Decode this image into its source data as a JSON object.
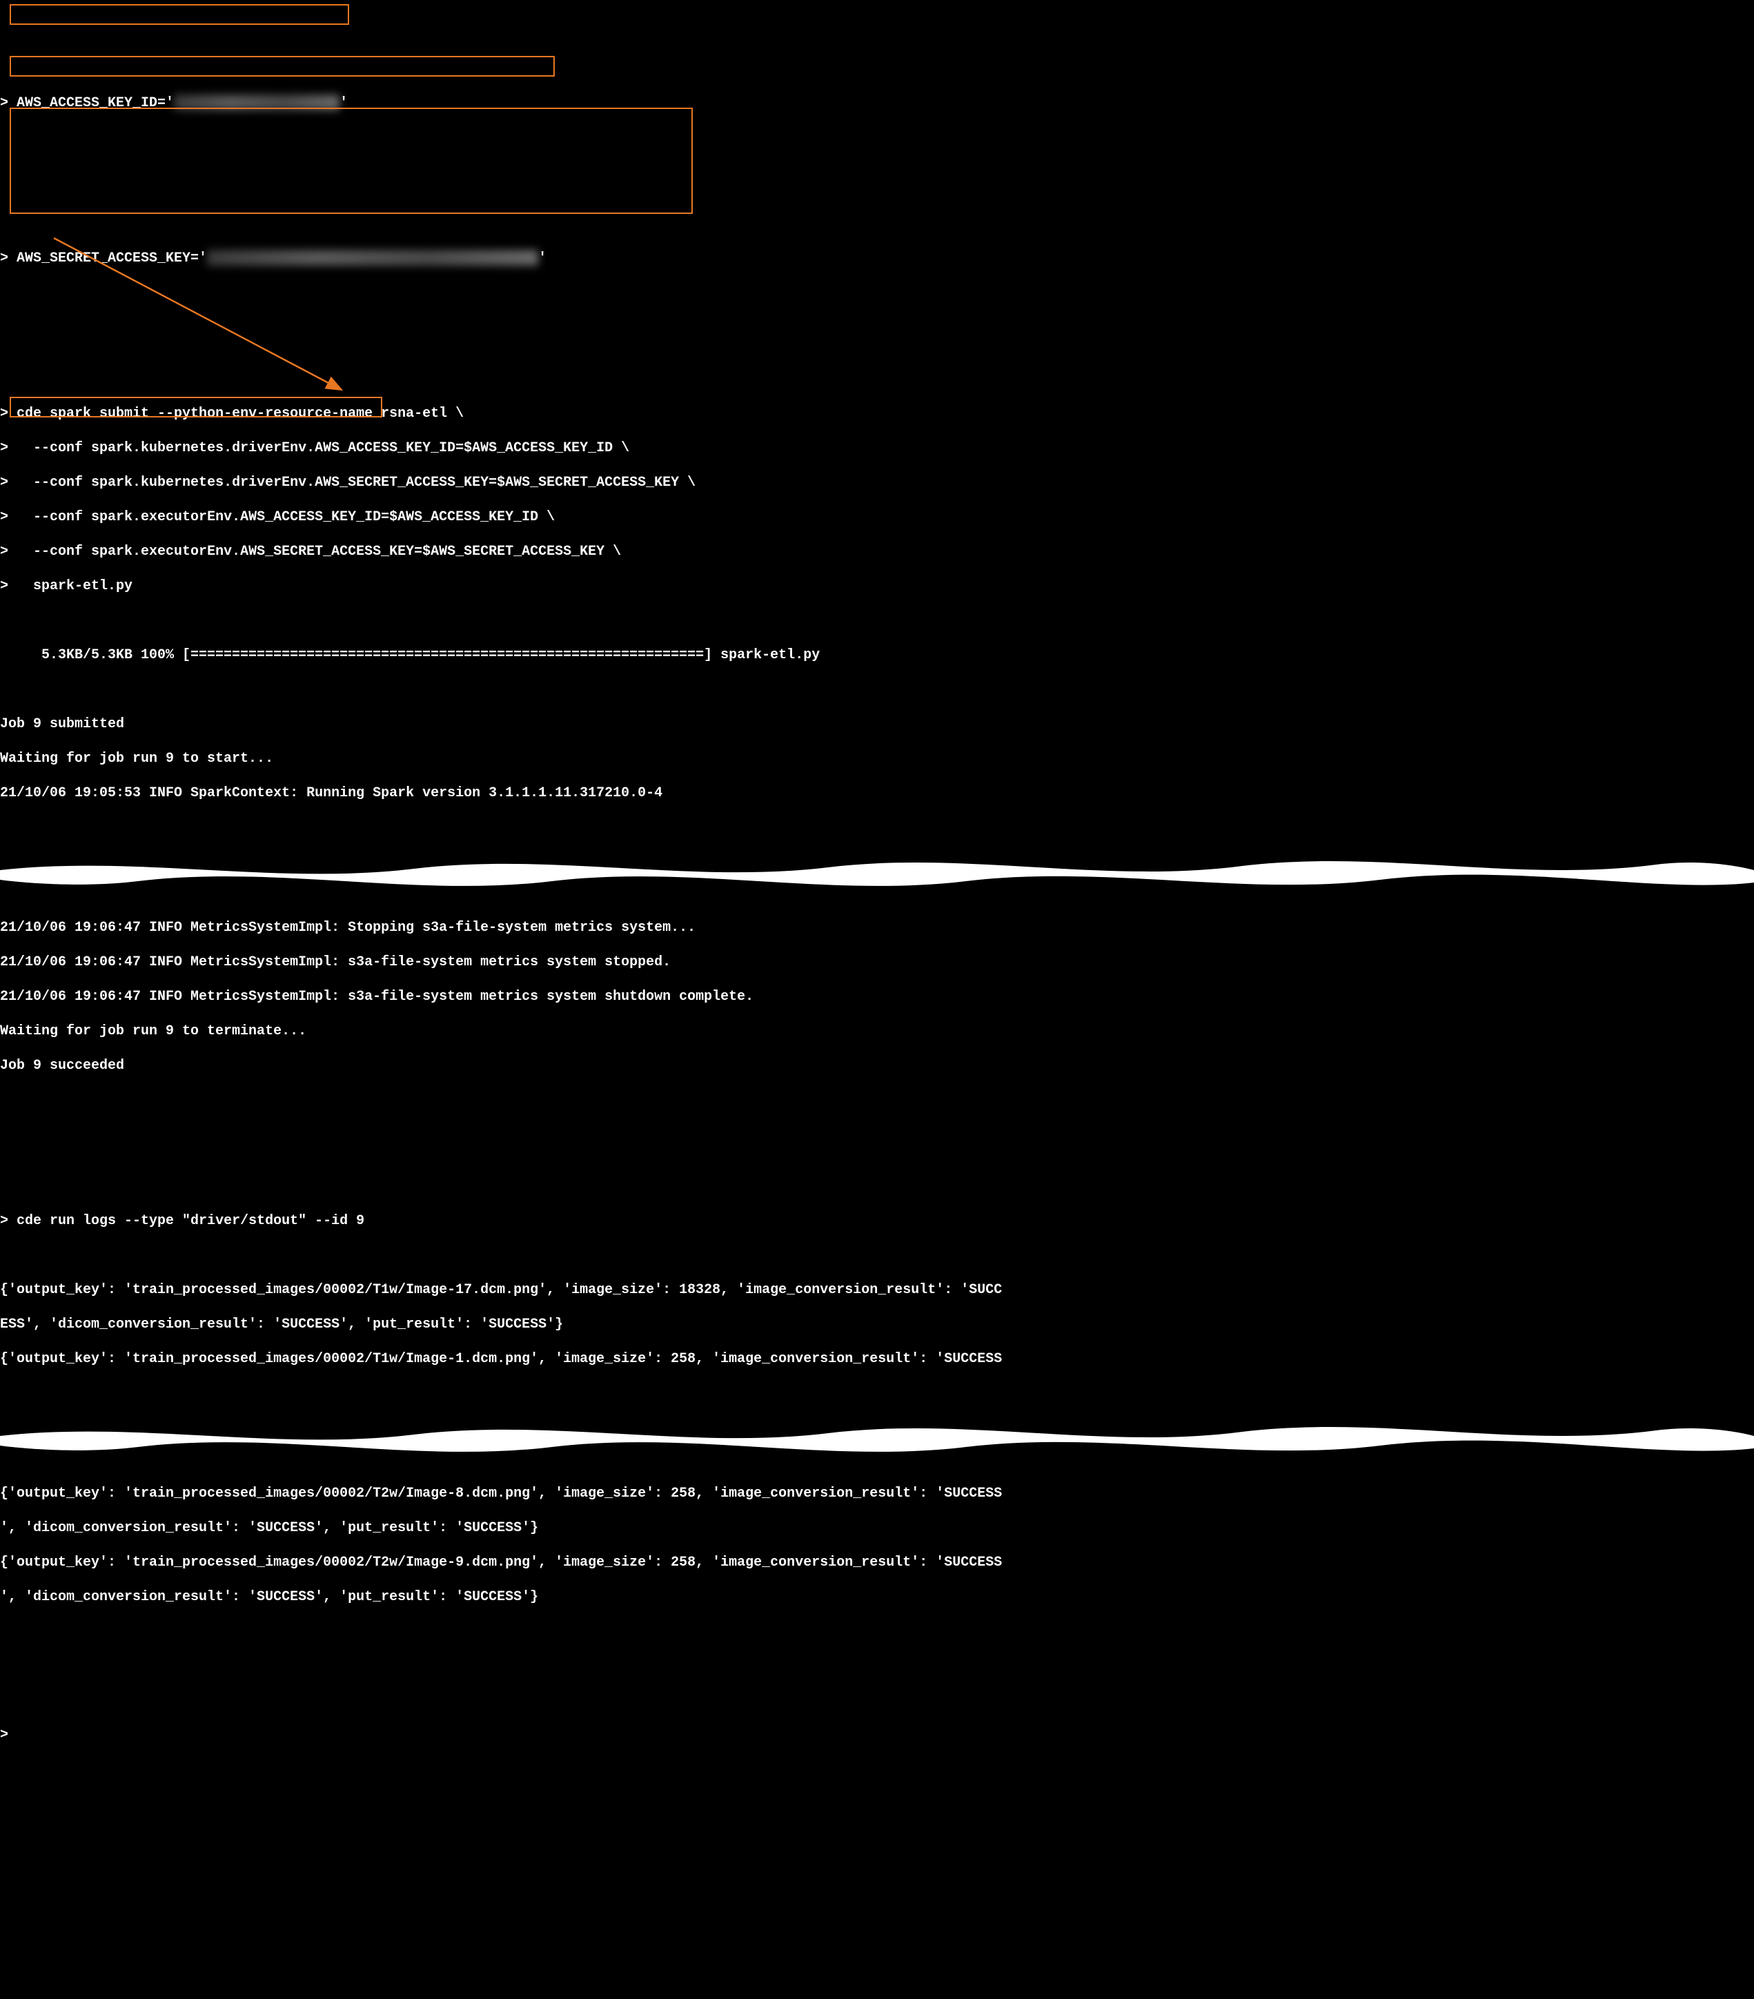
{
  "prompt": ">",
  "cmd1": {
    "pre": " AWS_ACCESS_KEY_ID='",
    "redacted": "████████████████████",
    "post": "'"
  },
  "cmd2": {
    "pre": " AWS_SECRET_ACCESS_KEY='",
    "redacted": "████████████████████████████████████████",
    "post": "'"
  },
  "cmd3": {
    "l1": " cde spark submit --python-env-resource-name rsna-etl \\",
    "l2": "   --conf spark.kubernetes.driverEnv.AWS_ACCESS_KEY_ID=$AWS_ACCESS_KEY_ID \\",
    "l3": "   --conf spark.kubernetes.driverEnv.AWS_SECRET_ACCESS_KEY=$AWS_SECRET_ACCESS_KEY \\",
    "l4": "   --conf spark.executorEnv.AWS_ACCESS_KEY_ID=$AWS_ACCESS_KEY_ID \\",
    "l5": "   --conf spark.executorEnv.AWS_SECRET_ACCESS_KEY=$AWS_SECRET_ACCESS_KEY \\",
    "l6": "   spark-etl.py"
  },
  "upload": "     5.3KB/5.3KB 100% [==============================================================] spark-etl.py",
  "out1": {
    "l1": "Job 9 submitted",
    "l2": "Waiting for job run 9 to start...",
    "l3": "21/10/06 19:05:53 INFO SparkContext: Running Spark version 3.1.1.1.11.317210.0-4"
  },
  "out2": {
    "l1": "21/10/06 19:06:47 INFO MetricsSystemImpl: Stopping s3a-file-system metrics system...",
    "l2": "21/10/06 19:06:47 INFO MetricsSystemImpl: s3a-file-system metrics system stopped.",
    "l3": "21/10/06 19:06:47 INFO MetricsSystemImpl: s3a-file-system metrics system shutdown complete.",
    "l4": "Waiting for job run 9 to terminate...",
    "l5": "Job 9 succeeded"
  },
  "cmd4": " cde run logs --type \"driver/stdout\" --id 9",
  "logs1": {
    "l1": "{'output_key': 'train_processed_images/00002/T1w/Image-17.dcm.png', 'image_size': 18328, 'image_conversion_result': 'SUCC",
    "l2": "ESS', 'dicom_conversion_result': 'SUCCESS', 'put_result': 'SUCCESS'}",
    "l3": "{'output_key': 'train_processed_images/00002/T1w/Image-1.dcm.png', 'image_size': 258, 'image_conversion_result': 'SUCCESS"
  },
  "logs2": {
    "l1": "{'output_key': 'train_processed_images/00002/T2w/Image-8.dcm.png', 'image_size': 258, 'image_conversion_result': 'SUCCESS",
    "l2": "', 'dicom_conversion_result': 'SUCCESS', 'put_result': 'SUCCESS'}",
    "l3": "{'output_key': 'train_processed_images/00002/T2w/Image-9.dcm.png', 'image_size': 258, 'image_conversion_result': 'SUCCESS",
    "l4": "', 'dicom_conversion_result': 'SUCCESS', 'put_result': 'SUCCESS'}"
  },
  "highlight_color": "#e87722"
}
